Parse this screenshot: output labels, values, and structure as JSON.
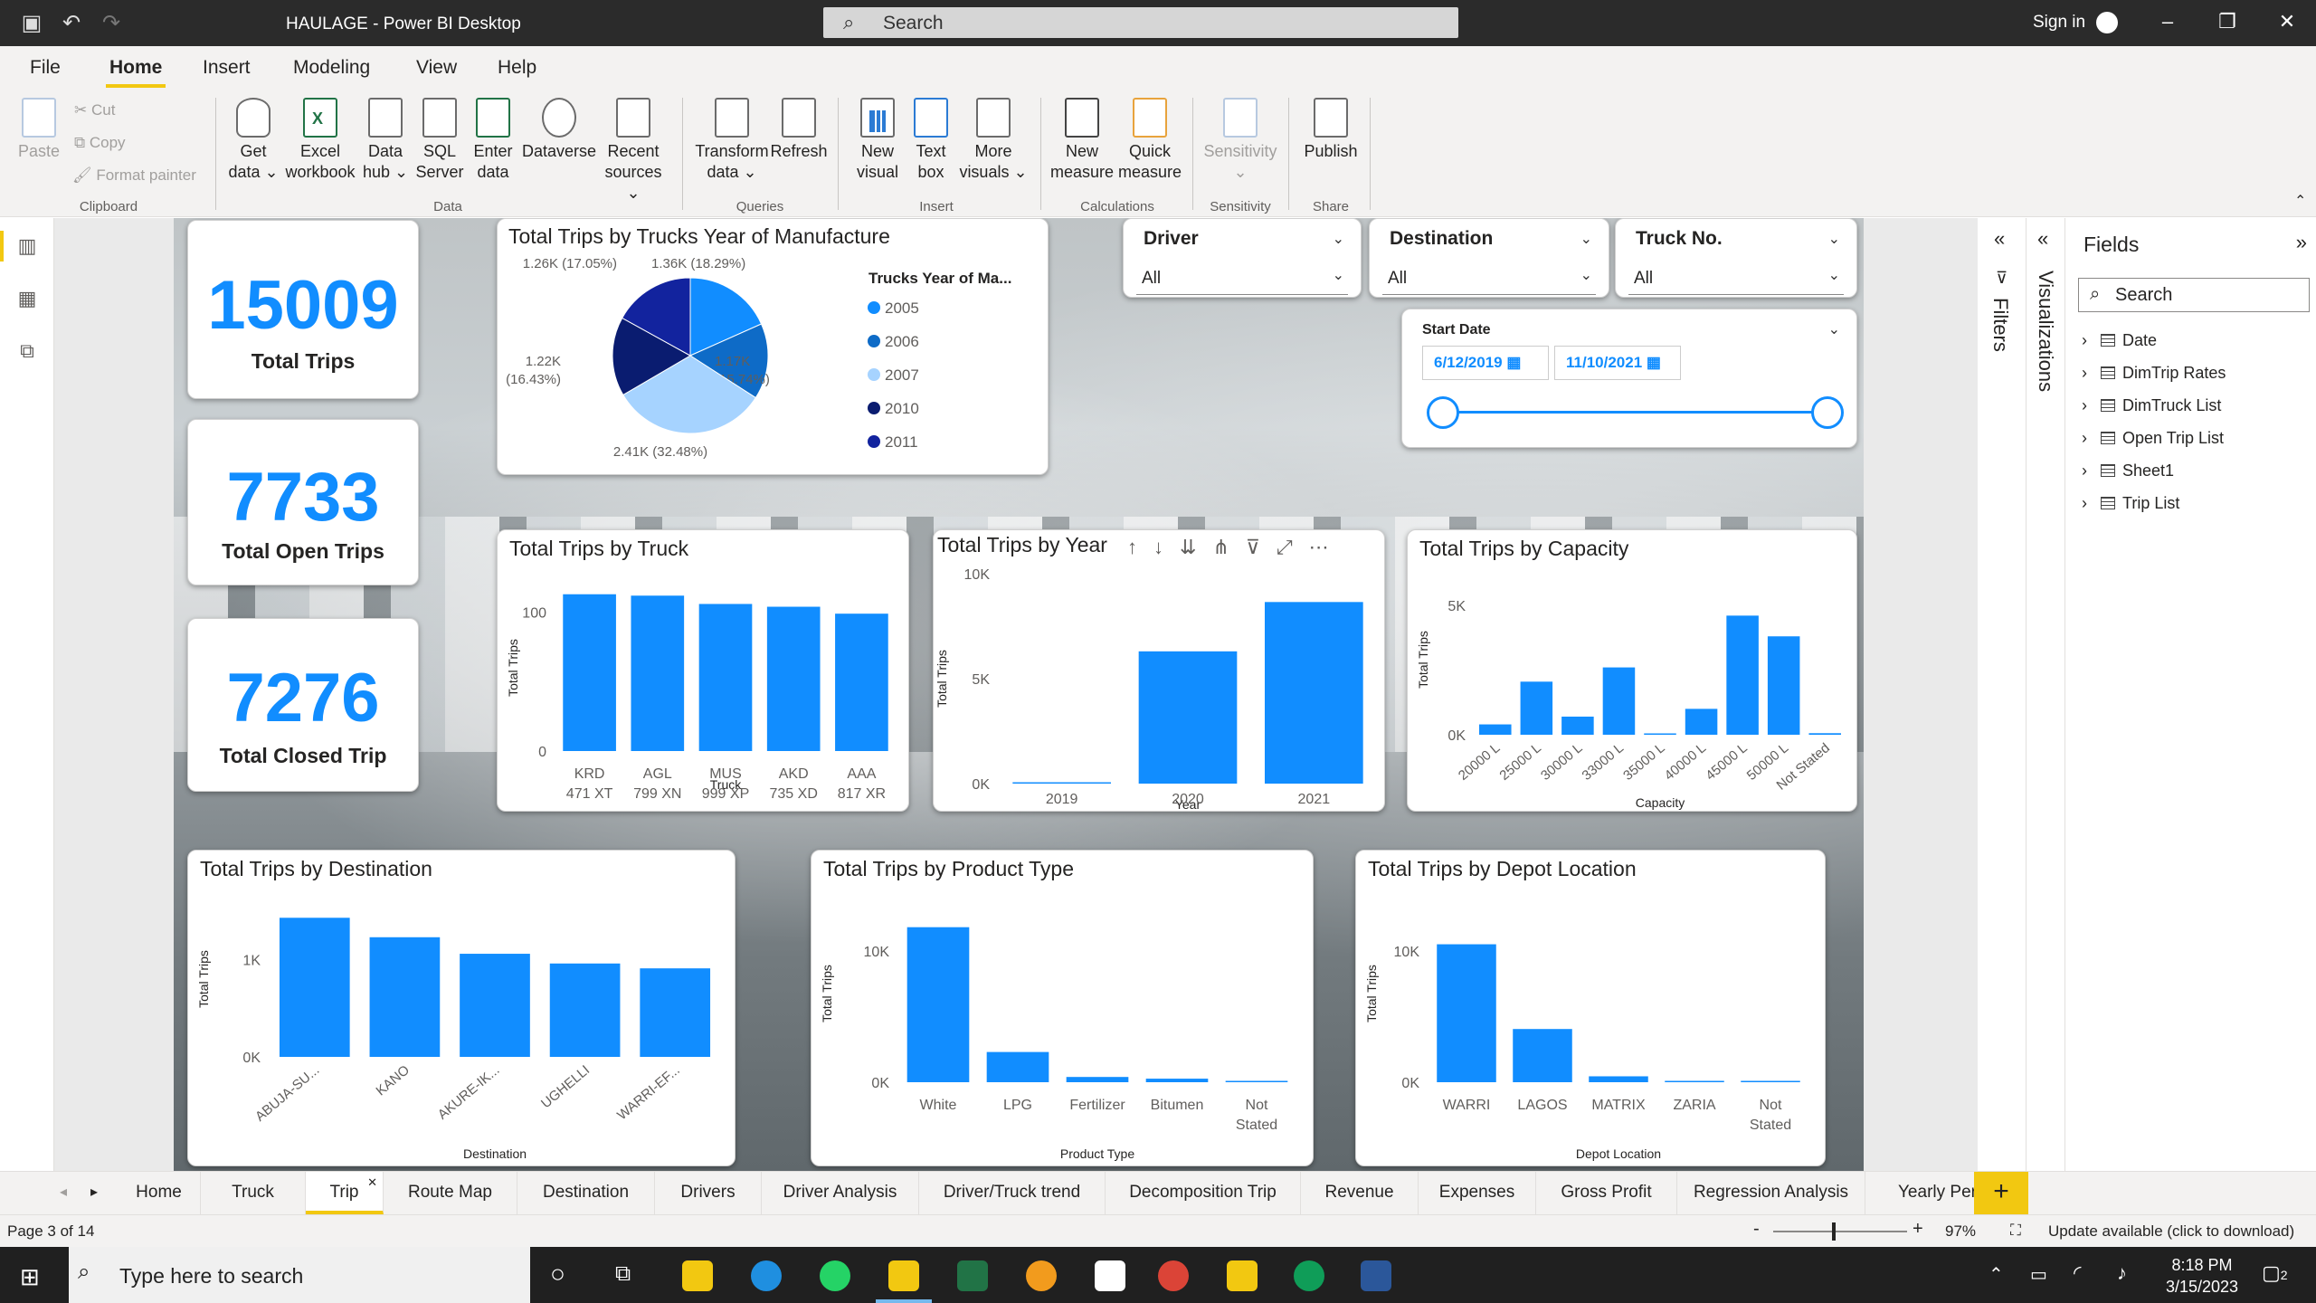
{
  "window": {
    "title": "HAULAGE - Power BI Desktop",
    "search_placeholder": "Search",
    "sign_in": "Sign in"
  },
  "menu": [
    "File",
    "Home",
    "Insert",
    "Modeling",
    "View",
    "Help"
  ],
  "ribbon": {
    "clipboard": {
      "paste": "Paste",
      "cut": "Cut",
      "copy": "Copy",
      "format_painter": "Format painter",
      "group": "Clipboard"
    },
    "data": {
      "get_data": [
        "Get",
        "data ⌄"
      ],
      "excel": [
        "Excel",
        "workbook"
      ],
      "data_hub": [
        "Data",
        "hub ⌄"
      ],
      "sql": [
        "SQL",
        "Server"
      ],
      "enter_data": [
        "Enter",
        "data"
      ],
      "dataverse": [
        "Dataverse",
        ""
      ],
      "recent": [
        "Recent",
        "sources ⌄"
      ],
      "group": "Data"
    },
    "queries": {
      "transform": [
        "Transform",
        "data ⌄"
      ],
      "refresh": [
        "Refresh",
        ""
      ],
      "group": "Queries"
    },
    "insert": {
      "new_visual": [
        "New",
        "visual"
      ],
      "text_box": [
        "Text",
        "box"
      ],
      "more_visuals": [
        "More",
        "visuals ⌄"
      ],
      "group": "Insert"
    },
    "calculations": {
      "new_measure": [
        "New",
        "measure"
      ],
      "quick_measure": [
        "Quick",
        "measure"
      ],
      "group": "Calculations"
    },
    "sensitivity": {
      "label": [
        "Sensitivity",
        "⌄"
      ],
      "group": "Sensitivity"
    },
    "share": {
      "publish": [
        "Publish",
        ""
      ],
      "group": "Share"
    }
  },
  "kpis": [
    {
      "value": "15009",
      "label": "Total Trips"
    },
    {
      "value": "7733",
      "label": "Total Open Trips"
    },
    {
      "value": "7276",
      "label": "Total Closed Trip"
    }
  ],
  "slicers": {
    "driver": {
      "title": "Driver",
      "value": "All"
    },
    "destination": {
      "title": "Destination",
      "value": "All"
    },
    "truck": {
      "title": "Truck No.",
      "value": "All"
    },
    "date": {
      "title": "Start Date",
      "from": "6/12/2019",
      "to": "11/10/2021"
    }
  },
  "chart_data": [
    {
      "id": "pie",
      "type": "pie",
      "title": "Total Trips by Trucks Year of Manufacture",
      "legend_title": "Trucks Year of Ma...",
      "categories": [
        "2005",
        "2006",
        "2007",
        "2010",
        "2011"
      ],
      "values": [
        1360,
        1170,
        2410,
        1220,
        1260
      ],
      "labels": [
        "1.36K (18.29%)",
        "1.17K (15.74%)",
        "2.41K (32.48%)",
        "1.22K (16.43%)",
        "1.26K (17.05%)"
      ],
      "colors": [
        "#118dff",
        "#0e6bc7",
        "#a6d3ff",
        "#0a1c70",
        "#12239e"
      ]
    },
    {
      "id": "truck",
      "type": "bar",
      "title": "Total Trips by Truck",
      "xlabel": "Truck",
      "ylabel": "Total Trips",
      "categories": [
        "KRD 471 XT",
        "AGL 799 XN",
        "MUS 999 XP",
        "AKD 735 XD",
        "AAA 817 XR"
      ],
      "values": [
        113,
        112,
        106,
        104,
        99
      ],
      "ylim": [
        0,
        120
      ],
      "yticks": [
        "0",
        "100"
      ],
      "ytick_values": [
        0,
        100
      ]
    },
    {
      "id": "year",
      "type": "bar",
      "title": "Total Trips by Year",
      "xlabel": "Year",
      "ylabel": "Total Trips",
      "categories": [
        "2019",
        "2020",
        "2021"
      ],
      "values": [
        60,
        6300,
        8650
      ],
      "ylim": [
        0,
        10000
      ],
      "yticks": [
        "0K",
        "5K",
        "10K"
      ],
      "ytick_values": [
        0,
        5000,
        10000
      ]
    },
    {
      "id": "capacity",
      "type": "bar",
      "title": "Total Trips by Capacity",
      "xlabel": "Capacity",
      "ylabel": "Total Trips",
      "categories": [
        "20000 L",
        "25000 L",
        "30000 L",
        "33000 L",
        "35000 L",
        "40000 L",
        "45000 L",
        "50000 L",
        "Not Stated"
      ],
      "values": [
        400,
        2050,
        700,
        2600,
        50,
        1000,
        4600,
        3800,
        60
      ],
      "ylim": [
        0,
        5800
      ],
      "yticks": [
        "0K",
        "5K"
      ],
      "ytick_values": [
        0,
        5000
      ]
    },
    {
      "id": "destination",
      "type": "bar",
      "title": "Total Trips by Destination",
      "xlabel": "Destination",
      "ylabel": "Total Trips",
      "categories": [
        "ABUJA-SU...",
        "KANO",
        "AKURE-IK...",
        "UGHELLI",
        "WARRI-EF..."
      ],
      "values": [
        1430,
        1230,
        1060,
        960,
        910
      ],
      "ylim": [
        0,
        1600
      ],
      "yticks": [
        "0K",
        "1K"
      ],
      "ytick_values": [
        0,
        1000
      ]
    },
    {
      "id": "product",
      "type": "bar",
      "title": "Total Trips by Product Type",
      "xlabel": "Product Type",
      "ylabel": "Total Trips",
      "categories": [
        "White",
        "LPG",
        "Fertilizer",
        "Bitumen",
        "Not Stated"
      ],
      "values": [
        11800,
        2300,
        400,
        270,
        80
      ],
      "ylim": [
        0,
        13500
      ],
      "yticks": [
        "0K",
        "10K"
      ],
      "ytick_values": [
        0,
        10000
      ]
    },
    {
      "id": "depot",
      "type": "bar",
      "title": "Total Trips by Depot Location",
      "xlabel": "Depot Location",
      "ylabel": "Total Trips",
      "categories": [
        "WARRI",
        "LAGOS",
        "MATRIX",
        "ZARIA",
        "Not Stated"
      ],
      "values": [
        10500,
        4050,
        450,
        100,
        60
      ],
      "ylim": [
        0,
        13500
      ],
      "yticks": [
        "0K",
        "10K"
      ],
      "ytick_values": [
        0,
        10000
      ]
    }
  ],
  "panes": {
    "filters": "Filters",
    "visualizations": "Visualizations",
    "fields": "Fields",
    "search": "Search",
    "tables": [
      "Date",
      "DimTrip Rates",
      "DimTruck List",
      "Open Trip List",
      "Sheet1",
      "Trip List"
    ]
  },
  "tabs": [
    "Home",
    "Truck",
    "Trip",
    "Route Map",
    "Destination",
    "Drivers",
    "Driver Analysis",
    "Driver/Truck trend",
    "Decomposition Trip",
    "Revenue",
    "Expenses",
    "Gross Profit",
    "Regression Analysis",
    "Yearly Perfo"
  ],
  "status": {
    "page": "Page 3 of 14",
    "zoom": "97%",
    "update": "Update available (click to download)"
  },
  "taskbar": {
    "search": "Type here to search",
    "time": "8:18 PM",
    "date": "3/15/2023",
    "notifications": "2"
  }
}
